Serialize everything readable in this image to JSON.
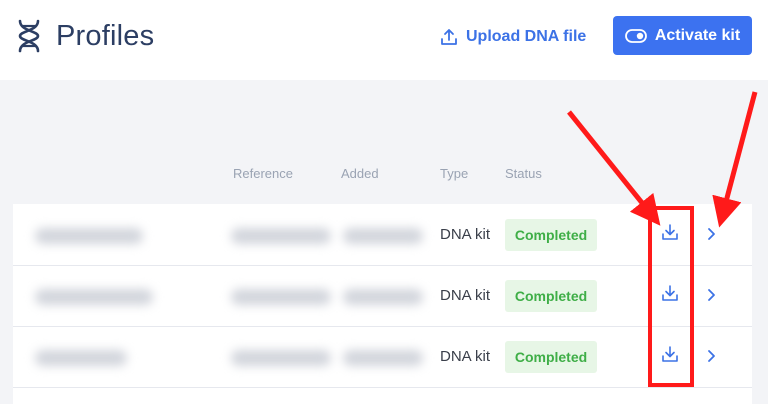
{
  "header": {
    "title": "Profiles",
    "upload_label": "Upload DNA file",
    "activate_label": "Activate kit",
    "icons": {
      "brand": "dna-icon",
      "upload": "upload-icon",
      "activate": "toggle-icon"
    }
  },
  "table": {
    "columns": [
      "Reference",
      "Added",
      "Type",
      "Status"
    ],
    "rows": [
      {
        "type": "DNA kit",
        "status": "Completed"
      },
      {
        "type": "DNA kit",
        "status": "Completed"
      },
      {
        "type": "DNA kit",
        "status": "Completed"
      }
    ],
    "row_icons": [
      "download-icon",
      "chevron-right-icon"
    ]
  },
  "colors": {
    "accent": "#3c72f0",
    "status_text": "#3fae47",
    "status_bg": "#e7f6e6",
    "annotation": "#ff1a1a"
  }
}
